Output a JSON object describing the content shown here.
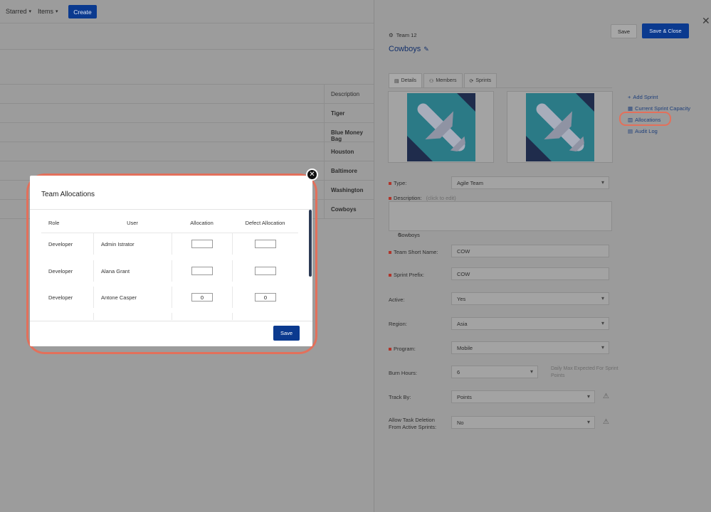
{
  "nav": {
    "starred": "Starred",
    "items": "Items",
    "create": "Create"
  },
  "list": {
    "description_header": "Description",
    "descriptions": [
      "Tiger",
      "Blue Money Bag",
      "Houston",
      "Baltimore",
      "Washington",
      "Cowboys"
    ]
  },
  "panel": {
    "team_id": "Team 12",
    "team_name": "Cowboys",
    "save": "Save",
    "save_close": "Save & Close",
    "tabs": [
      "Details",
      "Members",
      "Sprints"
    ],
    "side_links": [
      "Add Sprint",
      "Current Sprint Capacity",
      "Allocations",
      "Audit Log"
    ],
    "fields": {
      "type_label": "Type:",
      "type_value": "Agile Team",
      "description_label": "Description:",
      "description_hint": "(click to edit)",
      "description_value": "Cowboys",
      "short_name_label": "Team Short Name:",
      "short_name_value": "COW",
      "sprint_prefix_label": "Sprint Prefix:",
      "sprint_prefix_value": "COW",
      "active_label": "Active:",
      "active_value": "Yes",
      "region_label": "Region:",
      "region_value": "Asia",
      "program_label": "Program:",
      "program_value": "Mobile",
      "burn_label": "Burn Hours:",
      "burn_value": "6",
      "daily_note": "Daily Max Expected For Sprint Points",
      "track_label": "Track By:",
      "track_value": "Points",
      "allow_label": "Allow Task Deletion From Active Sprints:",
      "allow_value": "No"
    }
  },
  "modal": {
    "title": "Team Allocations",
    "headers": [
      "Role",
      "User",
      "Allocation",
      "Defect Allocation"
    ],
    "rows": [
      {
        "role": "Developer",
        "user": "Admin Istrator",
        "allocation": "",
        "defect": ""
      },
      {
        "role": "Developer",
        "user": "Alana Grant",
        "allocation": "",
        "defect": ""
      },
      {
        "role": "Developer",
        "user": "Antone Casper",
        "allocation": "0",
        "defect": "0"
      }
    ],
    "save": "Save"
  },
  "colors": {
    "primary": "#0b3a8f",
    "highlight": "#e3705b",
    "required": "#b0352b"
  }
}
